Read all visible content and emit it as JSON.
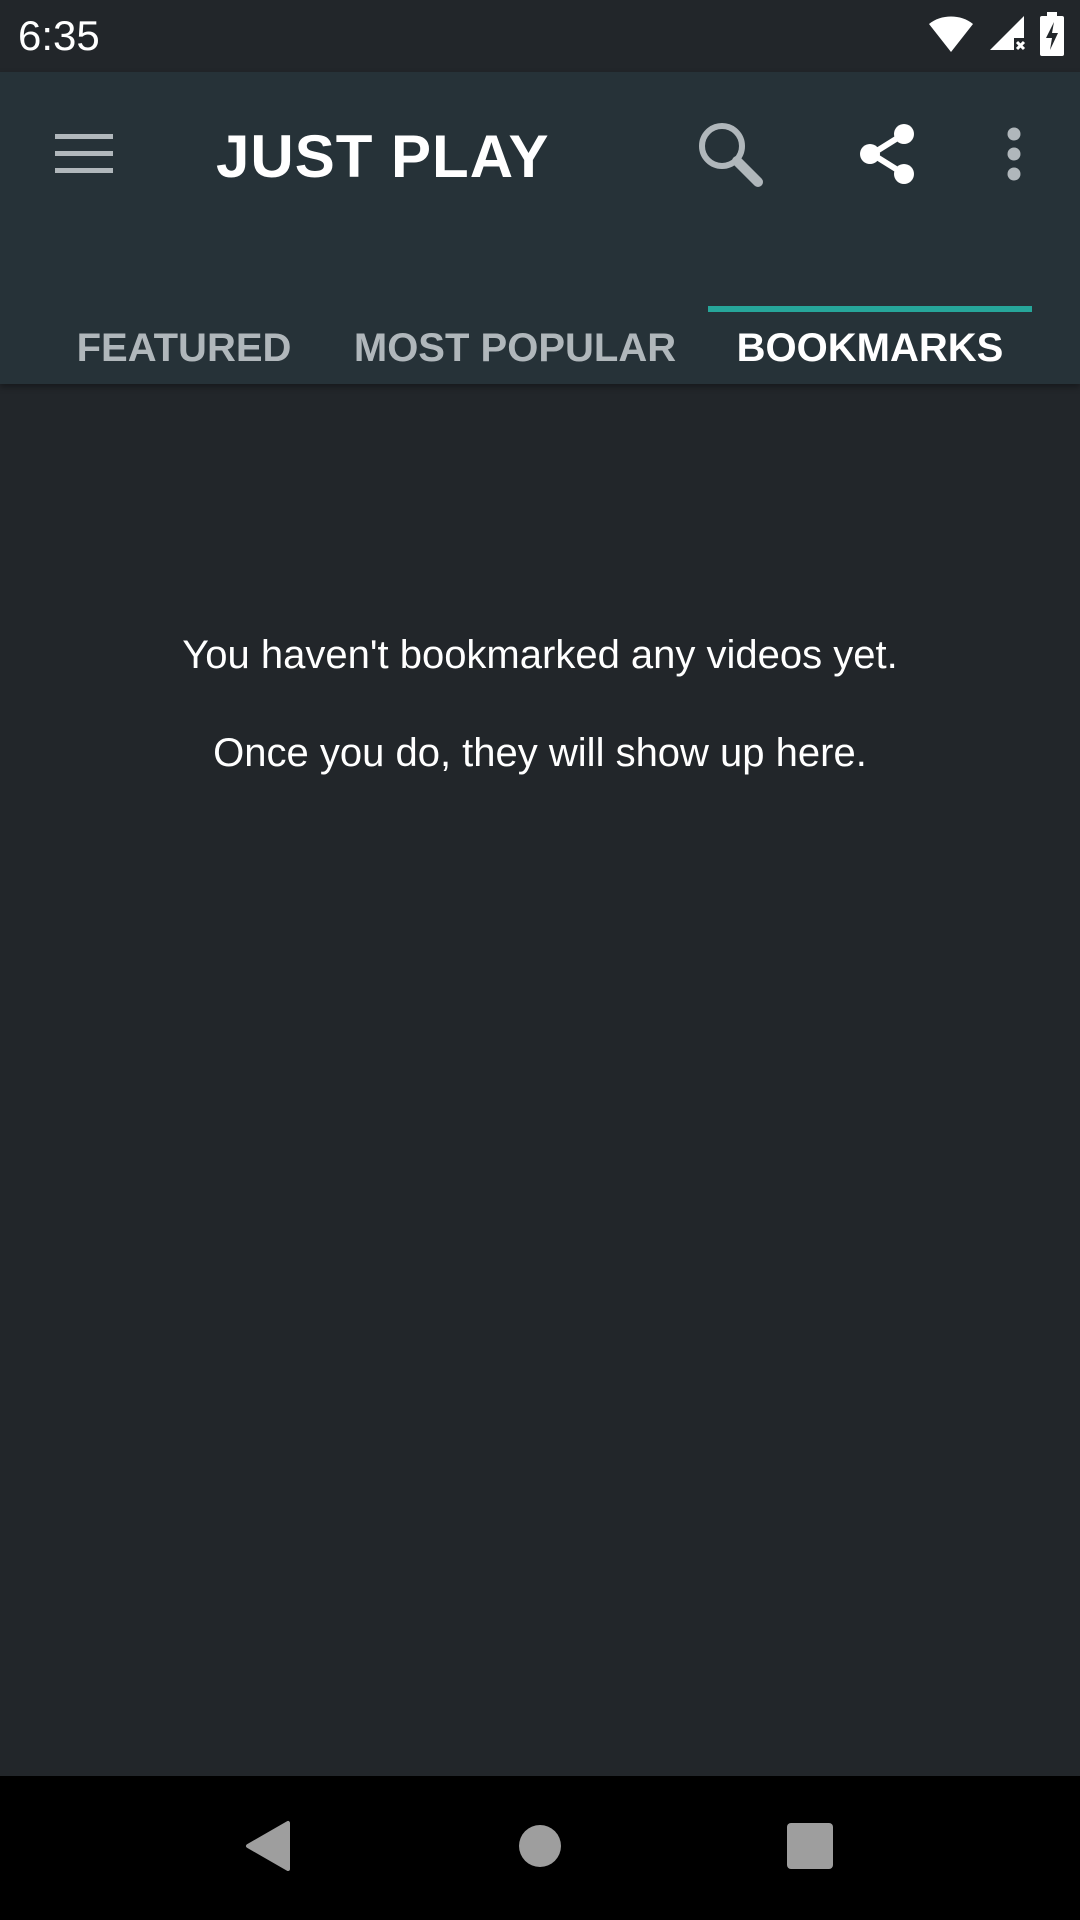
{
  "status_bar": {
    "time": "6:35",
    "icons": [
      "wifi-icon",
      "cellular-no-signal-icon",
      "battery-charging-icon"
    ]
  },
  "app_bar": {
    "title": "JUST PLAY",
    "actions": [
      "menu-icon",
      "search-icon",
      "share-icon",
      "more-vert-icon"
    ]
  },
  "tabs": [
    {
      "label": "FEATURED",
      "selected": false
    },
    {
      "label": "MOST POPULAR",
      "selected": false
    },
    {
      "label": "BOOKMARKS",
      "selected": true
    }
  ],
  "empty_state": {
    "line1": "You haven't bookmarked any videos yet.",
    "line2": "Once you do, they will show up here."
  },
  "nav_bar": {
    "icons": [
      "back-icon",
      "home-icon",
      "recents-icon"
    ]
  },
  "colors": {
    "background": "#22262a",
    "app_bar": "#263238",
    "accent": "#26a69a",
    "tab_inactive": "#b0b7bb",
    "text": "#ffffff"
  }
}
